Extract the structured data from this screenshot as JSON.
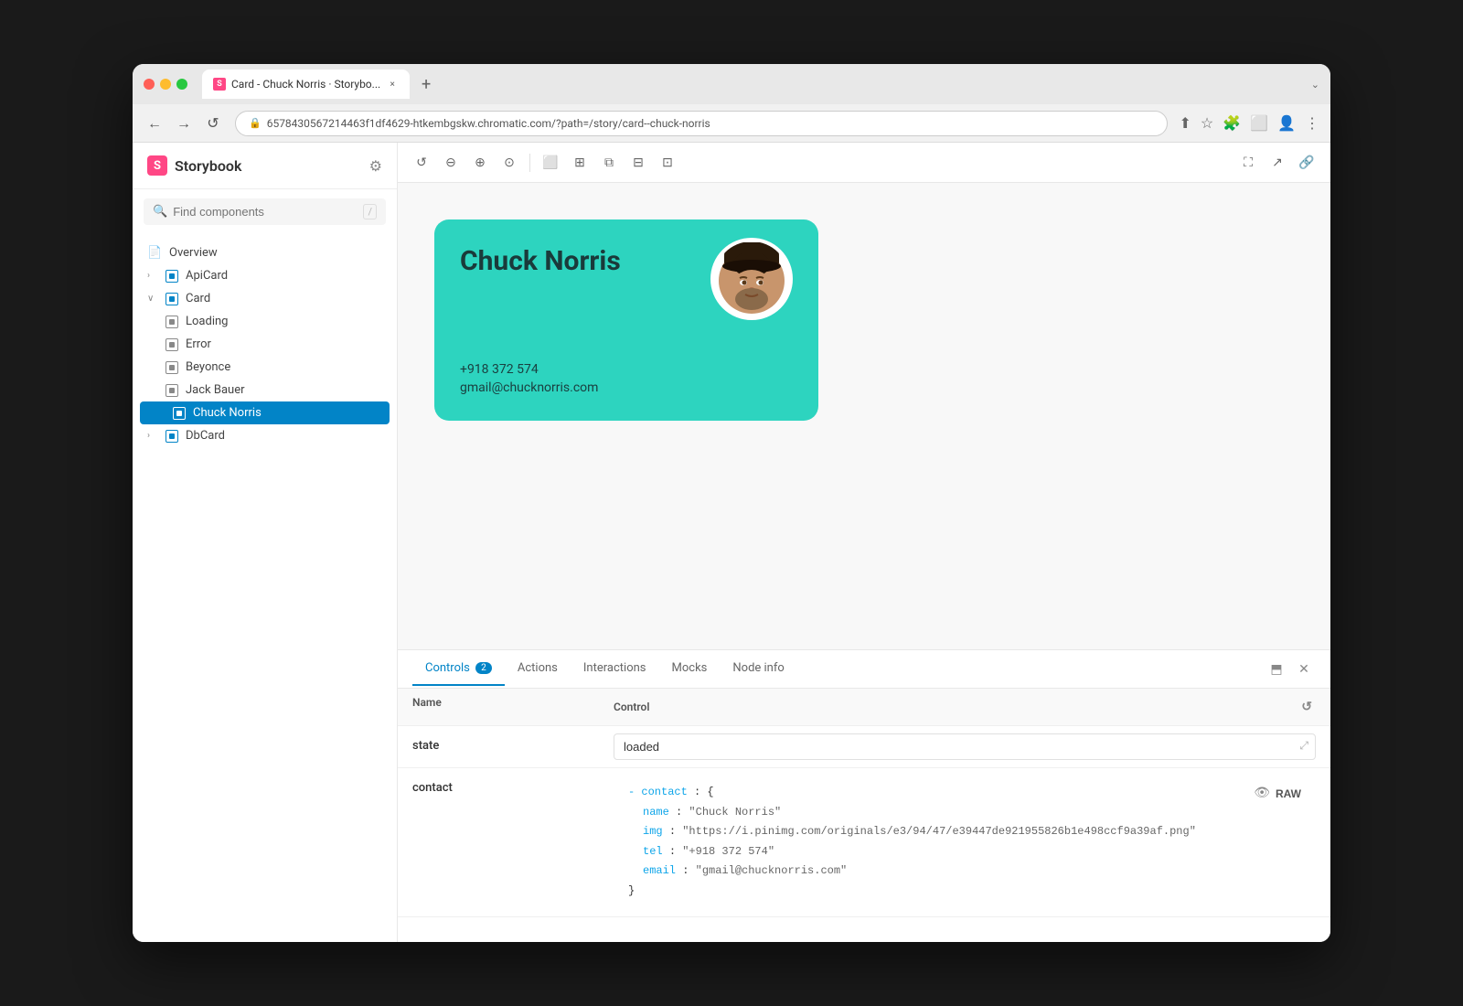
{
  "browser": {
    "tab_title": "Card - Chuck Norris · Storybo...",
    "tab_close": "×",
    "new_tab": "+",
    "address": "6578430567214463f1df4629-htkembgskw.chromatic.com",
    "address_path": "/?path=/story/card--chuck-norris",
    "collapse_label": "⌄",
    "nav_back": "←",
    "nav_forward": "→",
    "nav_refresh": "↺"
  },
  "sidebar": {
    "title": "Storybook",
    "search_placeholder": "Find components",
    "search_slash": "/",
    "items": [
      {
        "id": "overview",
        "label": "Overview",
        "type": "overview",
        "indent": 0
      },
      {
        "id": "apicard",
        "label": "ApiCard",
        "type": "component",
        "indent": 0,
        "toggle": "›"
      },
      {
        "id": "card",
        "label": "Card",
        "type": "component",
        "indent": 0,
        "toggle": "∨",
        "expanded": true
      },
      {
        "id": "loading",
        "label": "Loading",
        "type": "story",
        "indent": 1
      },
      {
        "id": "error",
        "label": "Error",
        "type": "story",
        "indent": 1
      },
      {
        "id": "beyonce",
        "label": "Beyonce",
        "type": "story",
        "indent": 1
      },
      {
        "id": "jackbauer",
        "label": "Jack Bauer",
        "type": "story",
        "indent": 1
      },
      {
        "id": "chucknorris",
        "label": "Chuck Norris",
        "type": "story",
        "indent": 1,
        "active": true
      },
      {
        "id": "dbcard",
        "label": "DbCard",
        "type": "component",
        "indent": 0,
        "toggle": "›"
      }
    ]
  },
  "toolbar": {
    "refresh_title": "Refresh",
    "zoom_in_title": "Zoom in",
    "zoom_out_title": "Zoom out",
    "zoom_reset_title": "Reset zoom",
    "frame_title": "Single story",
    "grid_title": "Grid",
    "copy_title": "Copy",
    "measure_title": "Measure",
    "outline_title": "Outline"
  },
  "card": {
    "name": "Chuck Norris",
    "phone": "+918 372 574",
    "email": "gmail@chucknorris.com"
  },
  "bottom_panel": {
    "tabs": [
      {
        "id": "controls",
        "label": "Controls",
        "badge": "2",
        "active": true
      },
      {
        "id": "actions",
        "label": "Actions",
        "active": false
      },
      {
        "id": "interactions",
        "label": "Interactions",
        "active": false
      },
      {
        "id": "mocks",
        "label": "Mocks",
        "active": false
      },
      {
        "id": "nodeinfo",
        "label": "Node info",
        "active": false
      }
    ],
    "table": {
      "col_name": "Name",
      "col_control": "Control",
      "rows": [
        {
          "name": "state",
          "control_value": "loaded",
          "control_type": "text"
        },
        {
          "name": "contact",
          "control_type": "json"
        }
      ]
    },
    "json": {
      "contact_key": "contact",
      "open_brace": "{",
      "name_key": "name",
      "name_val": "\"Chuck Norris\"",
      "img_key": "img",
      "img_val": "\"https://i.pinimg.com/originals/e3/94/47/e39447de921955826b1e498ccf9a39af.png\"",
      "tel_key": "tel",
      "tel_val": "\"+918 372 574\"",
      "email_key": "email",
      "email_val": "\"gmail@chucknorris.com\"",
      "close_brace": "}",
      "raw_label": "RAW"
    }
  }
}
